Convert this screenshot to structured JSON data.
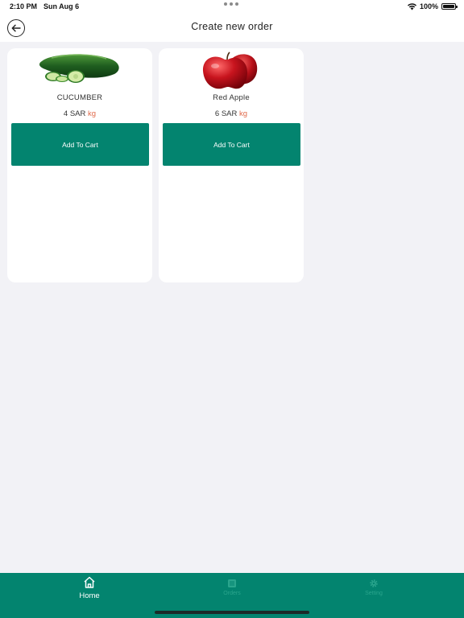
{
  "status_bar": {
    "time": "2:10 PM",
    "date": "Sun Aug 6",
    "battery_percent": "100%",
    "battery_level": 1.0
  },
  "header": {
    "title": "Create new order",
    "back_icon": "arrow-left-icon"
  },
  "products": [
    {
      "name": "CUCUMBER",
      "price": "4 SAR",
      "unit": "kg",
      "button_label": "Add To Cart",
      "image": "cucumber-image"
    },
    {
      "name": "Red Apple",
      "price": "6 SAR",
      "unit": "kg",
      "button_label": "Add To Cart",
      "image": "red-apple-image"
    }
  ],
  "tab_bar": {
    "tabs": [
      {
        "label": "Home",
        "icon": "home-icon",
        "active": true
      },
      {
        "label": "Orders",
        "icon": "orders-icon",
        "active": false
      },
      {
        "label": "Setting",
        "icon": "gear-icon",
        "active": false
      }
    ],
    "background_color": "#03846f"
  },
  "colors": {
    "accent": "#03846f",
    "unit_text": "#e06a4a",
    "page_background": "#f2f2f6"
  }
}
